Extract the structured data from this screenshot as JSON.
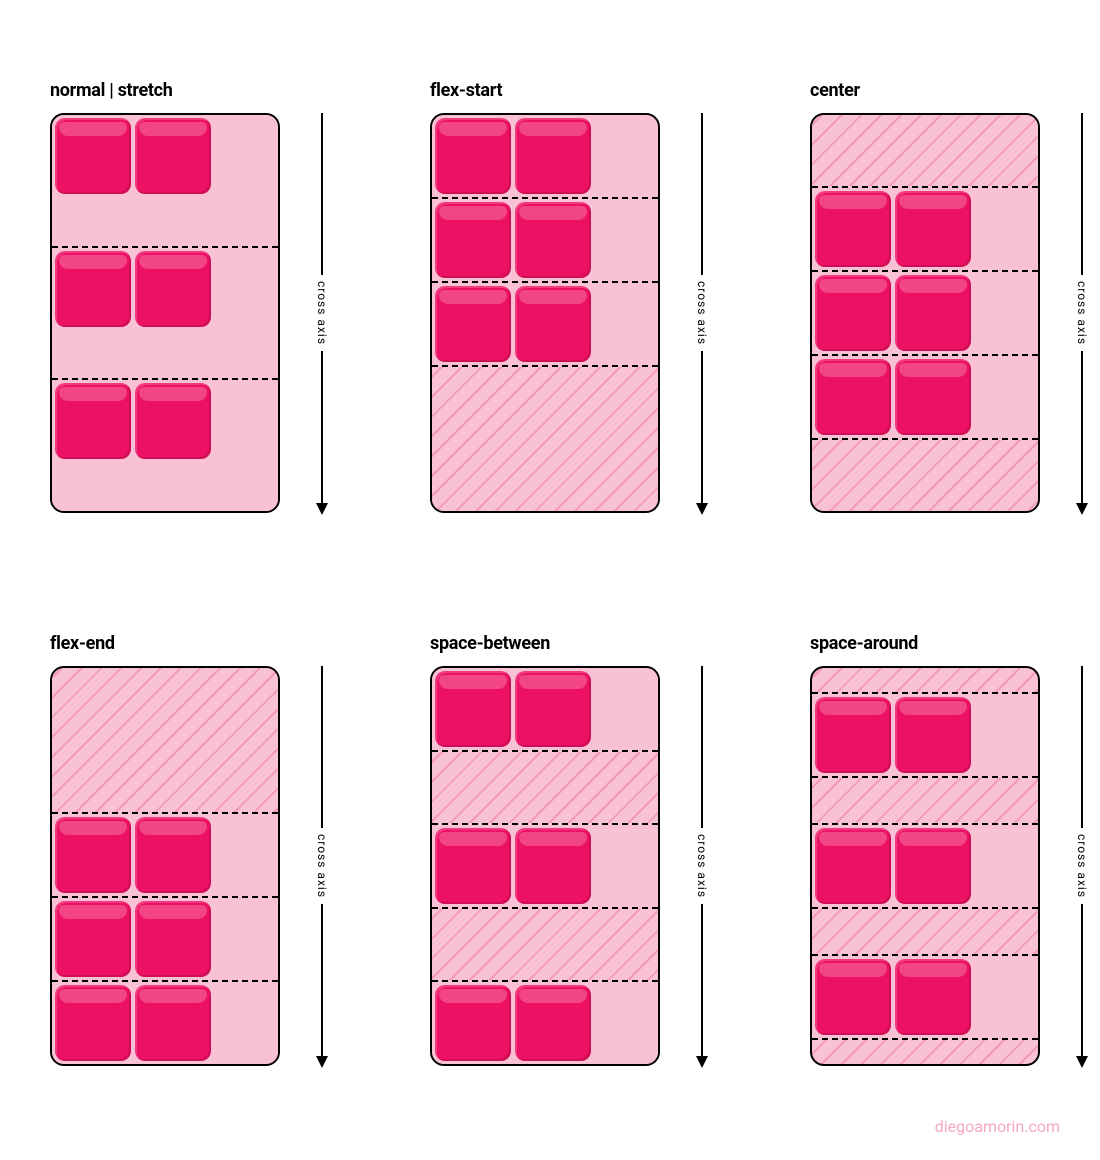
{
  "axis_label": "cross axis",
  "credit": "diegoamorin.com",
  "panels": [
    {
      "id": "stretch",
      "title": "normal | stretch",
      "mode": "stretch"
    },
    {
      "id": "flex-start",
      "title": "flex-start",
      "mode": "flex-start"
    },
    {
      "id": "center",
      "title": "center",
      "mode": "center"
    },
    {
      "id": "flex-end",
      "title": "flex-end",
      "mode": "flex-end"
    },
    {
      "id": "space-between",
      "title": "space-between",
      "mode": "space-between"
    },
    {
      "id": "space-around",
      "title": "space-around",
      "mode": "space-around"
    }
  ],
  "boxes_per_row": 2,
  "rows_per_container": 3,
  "chart_data": {
    "type": "diagram",
    "property": "align-content",
    "description": "CSS flexbox align-content values illustrated on a column-direction multi-line flex container. Pink container = flex container, crimson squares = flex items (2 per line, 3 lines). Diagonal hatching = empty cross-axis space redistributed by align-content. Dashed lines = flex-line boundaries. Arrow = cross axis.",
    "values": [
      {
        "value": "normal | stretch",
        "behavior": "Lines stretch to fill the container along the cross axis; no empty space remains.",
        "empty_space_regions": []
      },
      {
        "value": "flex-start",
        "behavior": "Lines pack toward the cross-start edge; all empty space is after the last line.",
        "empty_space_regions": [
          "after-all-lines"
        ]
      },
      {
        "value": "center",
        "behavior": "Lines pack toward the center; empty space is split equally before the first and after the last line.",
        "empty_space_regions": [
          "before-all-lines",
          "after-all-lines"
        ]
      },
      {
        "value": "flex-end",
        "behavior": "Lines pack toward the cross-end edge; all empty space is before the first line.",
        "empty_space_regions": [
          "before-all-lines"
        ]
      },
      {
        "value": "space-between",
        "behavior": "First line at cross-start, last at cross-end; remaining space distributed evenly between lines.",
        "empty_space_regions": [
          "between-line-1-and-2",
          "between-line-2-and-3"
        ]
      },
      {
        "value": "space-around",
        "behavior": "Space distributed evenly around every line; edge gaps are half the size of gaps between lines.",
        "empty_space_regions": [
          "half-before-line-1",
          "between-line-1-and-2",
          "between-line-2-and-3",
          "half-after-line-3"
        ]
      }
    ]
  }
}
